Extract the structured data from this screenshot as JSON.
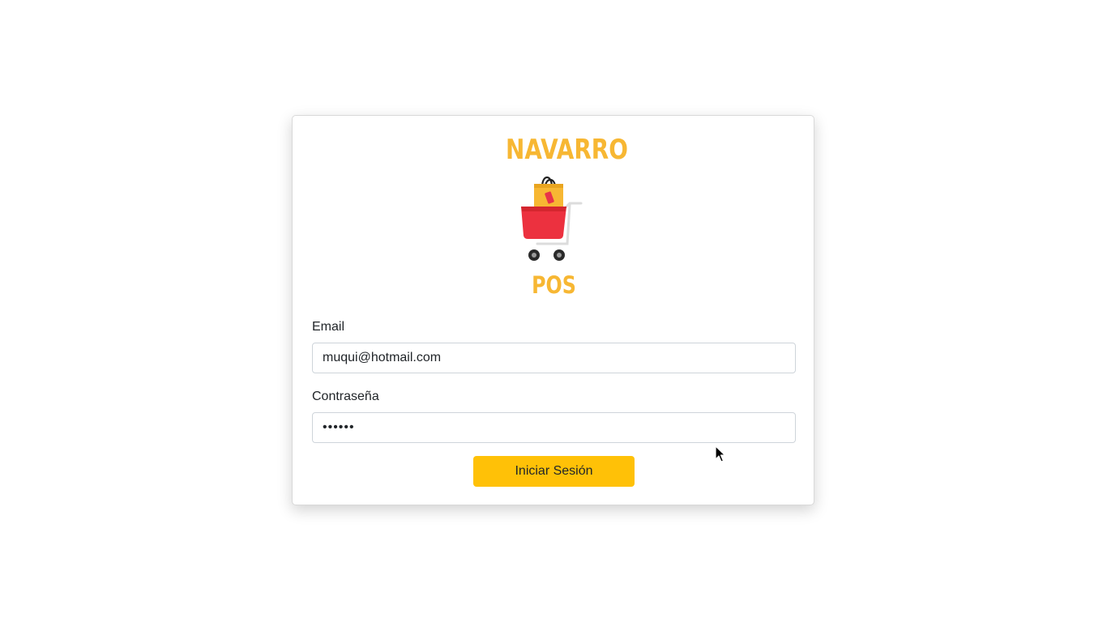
{
  "brand": {
    "name_top": "NAVARRO",
    "name_bottom": "POS",
    "logo_icon": "shopping-cart-bag-icon",
    "accent_color": "#f7b733"
  },
  "form": {
    "email_label": "Email",
    "email_value": "muqui@hotmail.com",
    "password_label": "Contraseña",
    "password_value": "••••••",
    "submit_label": "Iniciar Sesión",
    "submit_color": "#ffc107"
  }
}
